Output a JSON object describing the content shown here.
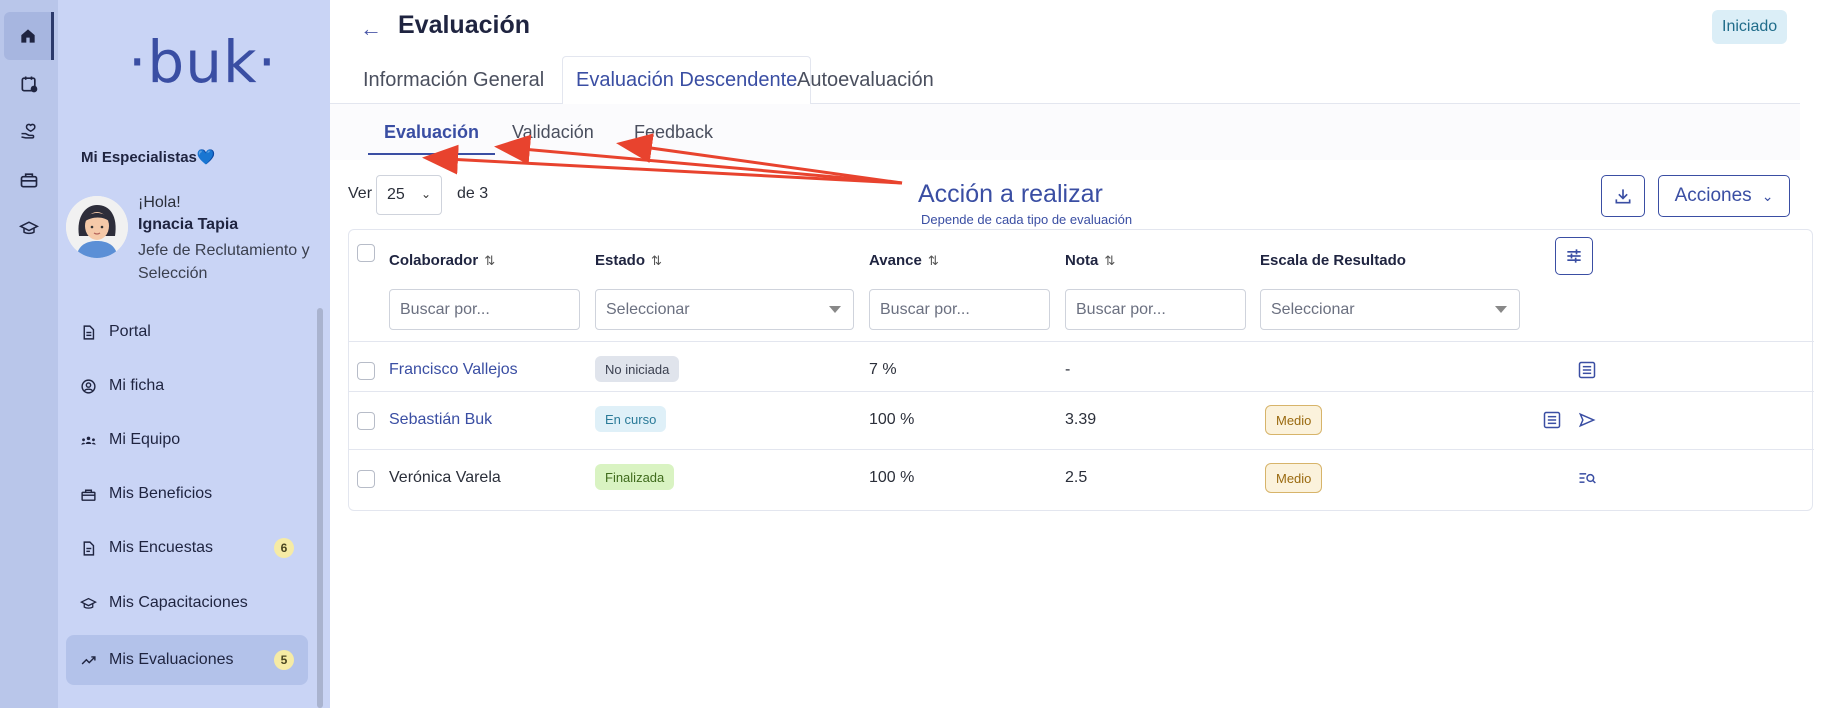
{
  "brand": {
    "logo_text": "·buk·",
    "primary_color": "#3a4ea3"
  },
  "rail": {
    "items": [
      {
        "icon": "home-icon",
        "active": true
      },
      {
        "icon": "calendar-icon"
      },
      {
        "icon": "heart-hand-icon"
      },
      {
        "icon": "briefcase-icon"
      },
      {
        "icon": "graduation-cap-icon"
      }
    ]
  },
  "sidebar": {
    "org": "Mi Especialistas💙",
    "greeting": "¡Hola!",
    "user_name": "Ignacia Tapia",
    "user_role": "Jefe de Reclutamiento y Selección",
    "items": [
      {
        "label": "Portal",
        "icon": "document-icon"
      },
      {
        "label": "Mi ficha",
        "icon": "user-circle-icon"
      },
      {
        "label": "Mi Equipo",
        "icon": "team-icon"
      },
      {
        "label": "Mis Beneficios",
        "icon": "gift-icon"
      },
      {
        "label": "Mis Encuestas",
        "icon": "survey-icon",
        "badge": "6"
      },
      {
        "label": "Mis Capacitaciones",
        "icon": "graduation-cap-icon"
      },
      {
        "label": "Mis Evaluaciones",
        "icon": "trend-icon",
        "badge": "5",
        "active": true
      }
    ]
  },
  "header": {
    "back_glyph": "←",
    "title": "Evaluación",
    "status": "Iniciado"
  },
  "tabs": [
    {
      "label": "Información General"
    },
    {
      "label": "Evaluación Descendente",
      "active": true
    },
    {
      "label": "Autoevaluación"
    }
  ],
  "subtabs": [
    {
      "label": "Evaluación",
      "active": true
    },
    {
      "label": "Validación"
    },
    {
      "label": "Feedback"
    }
  ],
  "pagination": {
    "ver_label": "Ver",
    "page_size": "25",
    "de_label": "de 3"
  },
  "annotation": {
    "title": "Acción a realizar",
    "subtitle": "Depende de cada tipo de evaluación",
    "color": "#e8432e"
  },
  "toolbar": {
    "acciones_label": "Acciones"
  },
  "table": {
    "columns": [
      {
        "label": "Colaborador",
        "sortable": true,
        "filter_placeholder": "Buscar por...",
        "filter_type": "text"
      },
      {
        "label": "Estado",
        "sortable": true,
        "filter_placeholder": "Seleccionar",
        "filter_type": "select"
      },
      {
        "label": "Avance",
        "sortable": true,
        "filter_placeholder": "Buscar por...",
        "filter_type": "text"
      },
      {
        "label": "Nota",
        "sortable": true,
        "filter_placeholder": "Buscar por...",
        "filter_type": "text"
      },
      {
        "label": "Escala de Resultado",
        "sortable": false,
        "filter_placeholder": "Seleccionar",
        "filter_type": "select"
      }
    ],
    "rows": [
      {
        "name": "Francisco Vallejos",
        "name_link": true,
        "estado": "No iniciada",
        "estado_color": "gray",
        "avance": "7 %",
        "nota": "-",
        "escala": "",
        "actions": [
          "list-icon"
        ]
      },
      {
        "name": "Sebastián Buk",
        "name_link": true,
        "estado": "En curso",
        "estado_color": "blue",
        "avance": "100 %",
        "nota": "3.39",
        "escala": "Medio",
        "actions": [
          "list-icon",
          "send-icon"
        ]
      },
      {
        "name": "Verónica Varela",
        "name_link": false,
        "estado": "Finalizada",
        "estado_color": "green",
        "avance": "100 %",
        "nota": "2.5",
        "escala": "Medio",
        "actions": [
          "list-search-icon"
        ]
      }
    ]
  }
}
